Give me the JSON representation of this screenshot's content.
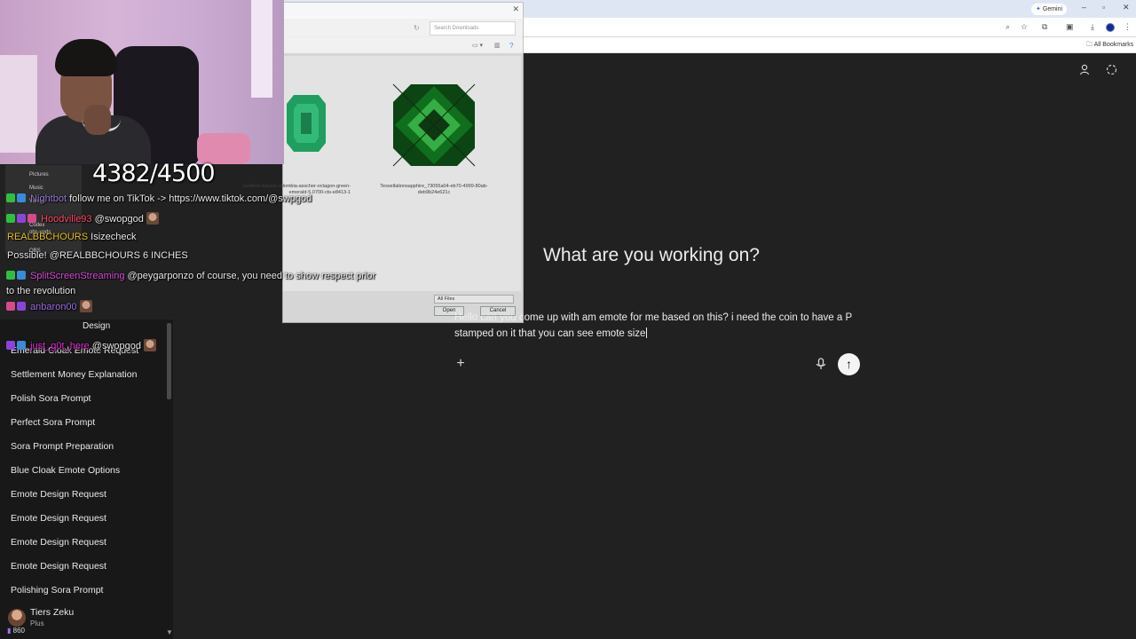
{
  "browser": {
    "gemini_label": "Gemini",
    "search_placeholder": "Search Downloads",
    "all_bookmarks": "All Bookmarks"
  },
  "main": {
    "headline": "What are you working on?",
    "prompt_text": "Hello can you come up with am emote for me based on this? i need the coin to have a P stamped on it that you can see emote size"
  },
  "sidebar": {
    "items": [
      "Emerald Cloak Emote Request",
      "Settlement Money Explanation",
      "Polish Sora Prompt",
      "Perfect Sora Prompt",
      "Sora Prompt Preparation",
      "Blue Cloak Emote Options",
      "Emote Design Request",
      "Emote Design Request",
      "Emote Design Request",
      "Emote Design Request",
      "Polishing Sora Prompt"
    ],
    "partial_item": "Design",
    "user_name": "Tiers Zeku",
    "user_plan": "Plus"
  },
  "file_dialog": {
    "file1_label": "certified-natural-colombia-asscher-octagon-green-emerald-5.0700-cts-e8413-1",
    "file2_label": "Tessellationsapphire_73055a04-eb70-4999-80ab-deb9b24e621c",
    "file_type": "All Files",
    "open_button": "Open",
    "cancel_button": "Cancel"
  },
  "stream": {
    "sub_goal": "4382/4500",
    "viewer_count": "860",
    "obs_rows": [
      "Pictures",
      "Music",
      "Videos",
      "Codex",
      "OBS",
      "obs-vods"
    ],
    "chat": [
      {
        "user": "Nightbot",
        "user_color": "#9a7ad8",
        "message": "follow me on TikTok -> https://www.tiktok.com/@swpgod"
      },
      {
        "user": "Hoodville93",
        "user_color": "#ff4a6a",
        "message": "@swopgod"
      },
      {
        "user": "REALBBCHOURS",
        "user_color": "#e8c020",
        "message": "Isizecheck"
      },
      {
        "user": "",
        "user_color": "#e8e8e8",
        "message": "Possible! @REALBBCHOURS 6 INCHES"
      },
      {
        "user": "SplitScreenStreaming",
        "user_color": "#d84ad8",
        "message": "@peygarponzo of course, you need to show respect prior to the revolution"
      },
      {
        "user": "anbaron00",
        "user_color": "#9a6ae8",
        "message": ""
      },
      {
        "user": "just_g0t_here",
        "user_color": "#e82ad8",
        "message": "@swopgod"
      }
    ]
  }
}
